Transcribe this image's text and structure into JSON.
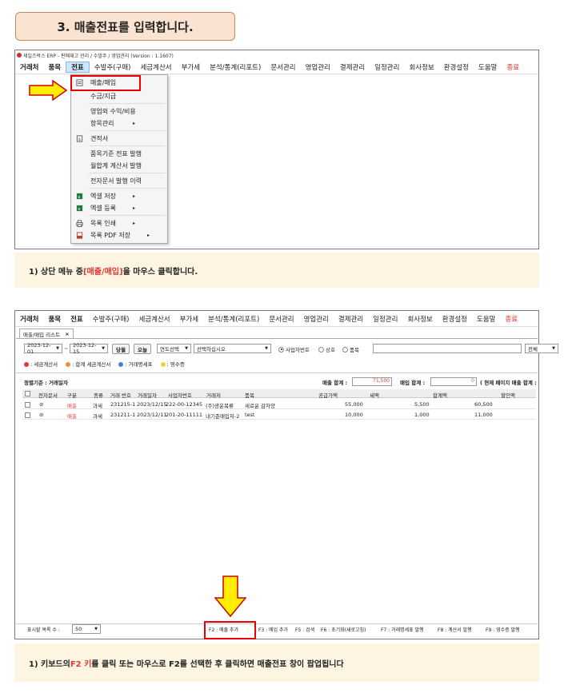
{
  "step_title": "3. 매출전표를 입력합니다.",
  "win1": {
    "title": "세일즈박스 ERP - 판매재고 관리 / 수발주 / 영업관리 (Version : 1.1607)",
    "menu": [
      "거래처",
      "품목",
      "전표",
      "수발주(구매)",
      "세금계산서",
      "부가세",
      "분석/통계(리포트)",
      "문서관리",
      "영업관리",
      "결제관리",
      "일정관리",
      "회사정보",
      "환경설정",
      "도움말",
      "종료"
    ],
    "dropdown": [
      "매출/매입",
      "수금/지급",
      "영업외 수익/비용",
      "항목관리",
      "견적서",
      "품목기준 전표 발행",
      "월합계 계산서 발행",
      "전자문서 발행 이력",
      "엑셀 저장",
      "엑셀 등록",
      "목록 인쇄",
      "목록 PDF 저장"
    ]
  },
  "note1": {
    "prefix": "1) 상단  메뉴 중 ",
    "highlight": "[매출/매입]",
    "suffix": "을  마우스 클릭합니다."
  },
  "win2": {
    "menu": [
      "거래처",
      "품목",
      "전표",
      "수발주(구매)",
      "세금계산서",
      "부가세",
      "분석/통계(리포트)",
      "문서관리",
      "영업관리",
      "결제관리",
      "일정관리",
      "회사정보",
      "환경설정",
      "도움말",
      "종료"
    ],
    "tab_label": "매출/매입 리스트",
    "tab_close": "×",
    "date_from": "2023-12-01",
    "date_to": "2023-12-15",
    "date_sep": "~",
    "btn_month": "당월",
    "btn_today": "오늘",
    "year_select": "연도선택",
    "choose_select": "선택하십시오",
    "radios": [
      "사업자번호",
      "상호",
      "품목"
    ],
    "all_select": "전체",
    "legend": [
      {
        "color": "#e53935",
        "label": ": 세금계산서"
      },
      {
        "color": "#ef8f3a",
        "label": ": 합계 세금계산서"
      },
      {
        "color": "#4a7fd6",
        "label": ": 거래명세표"
      },
      {
        "color": "#f2cf3a",
        "label": ": 영수증"
      }
    ],
    "sort_label": "정렬기준 : 거래일자",
    "sales_total_label": "매출 합계 :",
    "sales_total_value": "71,500",
    "purchase_total_label": "매입 합계 :",
    "purchase_total_value": "0",
    "page_total_label": "( 현재 페이지 매출 합계 :",
    "columns": [
      "전자문서",
      "구분",
      "종류",
      "거래 번호",
      "거래일자",
      "사업자번호",
      "거래처",
      "품목",
      "공급가액",
      "세액",
      "합계액",
      "할인액"
    ],
    "rows": [
      {
        "doc": "⊘",
        "kind": "매출",
        "type": "과세",
        "no": "231215-1",
        "date": "2023/12/15",
        "biz": "222-00-12345",
        "client": "(주)광운목류",
        "item": "새로운 감자양",
        "supply": "55,000",
        "tax": "5,500",
        "total": "60,500"
      },
      {
        "doc": "⊘",
        "kind": "매출",
        "type": "과세",
        "no": "231211-1",
        "date": "2023/12/11",
        "biz": "201-20-11111",
        "client": "내기준매입처-2",
        "item": "test",
        "supply": "10,000",
        "tax": "1,000",
        "total": "11,000"
      }
    ],
    "display_count_label": "표시할 목록 수 :",
    "display_count": "50",
    "keys": [
      "F2 : 매출 추가",
      "F3 : 매입 추가",
      "F5 : 검색",
      "F6 : 초기화(새로고침)",
      "F7 : 거래명세표 발행",
      "F8 : 계산서 발행",
      "F9 : 영수증 발행"
    ]
  },
  "note2": {
    "prefix": "1) 키보드의 ",
    "highlight": "F2 키",
    "suffix": "를 클릭 또는 마우스로 F2를 선택한 후 클릭하면 매출전표 창이 팝업됩니다"
  }
}
